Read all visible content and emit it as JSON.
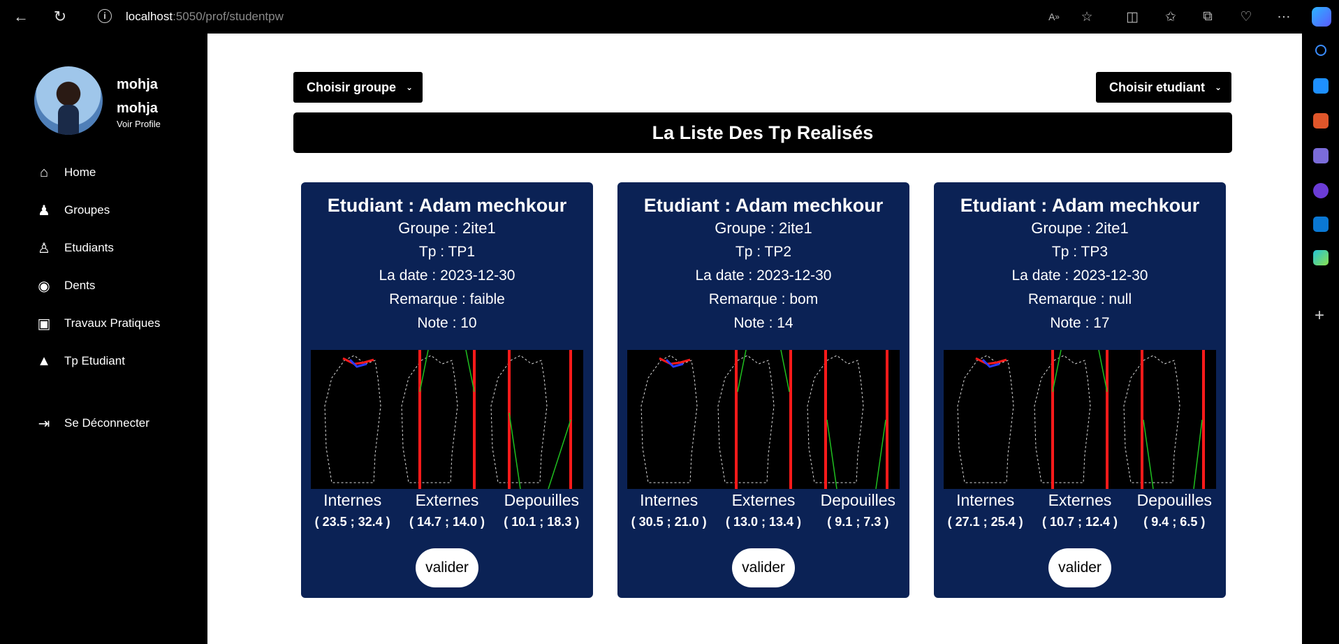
{
  "browser": {
    "url_host": "localhost",
    "url_path": ":5050/prof/studentpw"
  },
  "sidebar": {
    "user_first": "mohja",
    "user_last": "mohja",
    "voir_profile": "Voir Profile",
    "items": [
      {
        "label": "Home",
        "icon": "home-icon"
      },
      {
        "label": "Groupes",
        "icon": "group-icon"
      },
      {
        "label": "Etudiants",
        "icon": "user-icon"
      },
      {
        "label": "Dents",
        "icon": "tooth-icon"
      },
      {
        "label": "Travaux Pratiques",
        "icon": "briefcase-icon"
      },
      {
        "label": "Tp Etudiant",
        "icon": "graduation-cap-icon"
      }
    ],
    "logout": "Se Déconnecter"
  },
  "main": {
    "choose_group": "Choisir groupe",
    "choose_student": "Choisir etudiant",
    "title": "La Liste Des Tp Realisés",
    "labels": {
      "internes": "Internes",
      "externes": "Externes",
      "depouilles": "Depouilles"
    },
    "valider": "valider",
    "cards": [
      {
        "student": "Etudiant : Adam mechkour",
        "groupe": "Groupe : 2ite1",
        "tp": "Tp : TP1",
        "date": "La date : 2023-12-30",
        "remarque": "Remarque : faible",
        "note": "Note : 10",
        "internes": "( 23.5 ; 32.4 )",
        "externes": "( 14.7 ; 14.0 )",
        "depouilles": "( 10.1 ; 18.3 )"
      },
      {
        "student": "Etudiant : Adam mechkour",
        "groupe": "Groupe : 2ite1",
        "tp": "Tp : TP2",
        "date": "La date : 2023-12-30",
        "remarque": "Remarque : bom",
        "note": "Note : 14",
        "internes": "( 30.5 ; 21.0 )",
        "externes": "( 13.0 ; 13.4 )",
        "depouilles": "( 9.1 ; 7.3 )"
      },
      {
        "student": "Etudiant : Adam mechkour",
        "groupe": "Groupe : 2ite1",
        "tp": "Tp : TP3",
        "date": "La date : 2023-12-30",
        "remarque": "Remarque : null",
        "note": "Note : 17",
        "internes": "( 27.1 ; 25.4 )",
        "externes": "( 10.7 ; 12.4 )",
        "depouilles": "( 9.4 ; 6.5 )"
      }
    ]
  },
  "colors": {
    "card_bg": "#0b2255",
    "accent_red": "#ff1a1a",
    "accent_green": "#1fbf1f",
    "accent_blue": "#2a3bff"
  }
}
